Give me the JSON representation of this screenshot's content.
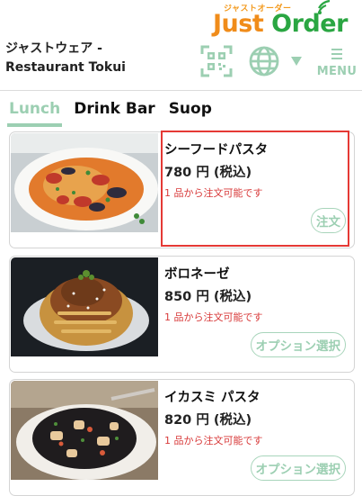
{
  "logo": {
    "tagline": "ジャストオーダー",
    "word1": "Just",
    "word2": "Order",
    "colors": {
      "orange": "#f08c1a",
      "green": "#2aa642"
    }
  },
  "header": {
    "restaurant_line1": "ジャストウェア -",
    "restaurant_line2": "Restaurant Tokui",
    "qr_icon": "qr-code-icon",
    "globe_icon": "globe-icon",
    "caret_icon": "caret-down-icon",
    "menu_label": "MENU"
  },
  "tabs": [
    {
      "label": "Lunch",
      "active": true
    },
    {
      "label": "Drink Bar",
      "active": false
    },
    {
      "label": "Suop",
      "active": false
    }
  ],
  "items": [
    {
      "name": "シーフードパスタ",
      "price": "780 円 (税込)",
      "note": "1 品から注文可能です",
      "button": "注文",
      "image": "seafood-pasta-photo"
    },
    {
      "name": "ボロネーゼ",
      "price": "850 円 (税込)",
      "note": "1 品から注文可能です",
      "button": "オプション選択",
      "image": "bolognese-photo"
    },
    {
      "name": "イカスミ パスタ",
      "price": "820 円 (税込)",
      "note": "1 品から注文可能です",
      "button": "オプション選択",
      "image": "squid-ink-pasta-photo"
    }
  ],
  "theme": {
    "accent": "#9ccfb2",
    "note_red": "#d83a3a",
    "highlight": "#e53935"
  }
}
